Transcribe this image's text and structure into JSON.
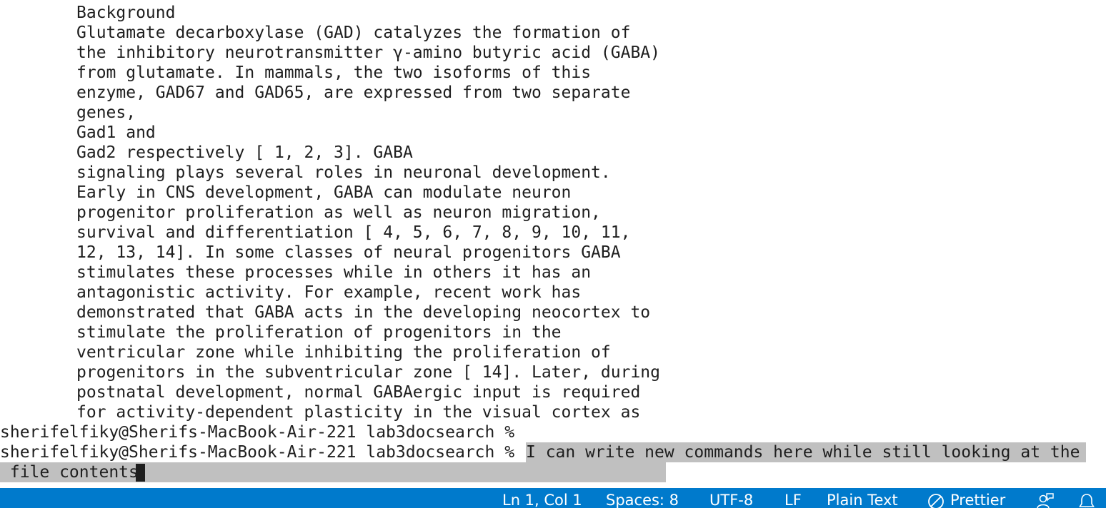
{
  "terminal": {
    "lines": [
      "Background",
      "Glutamate decarboxylase (GAD) catalyzes the formation of",
      "the inhibitory neurotransmitter γ-amino butyric acid (GABA)",
      "from glutamate. In mammals, the two isoforms of this",
      "enzyme, GAD67 and GAD65, are expressed from two separate",
      "genes,",
      "Gad1 and",
      "Gad2 respectively [ 1, 2, 3]. GABA",
      "signaling plays several roles in neuronal development.",
      "Early in CNS development, GABA can modulate neuron",
      "progenitor proliferation as well as neuron migration,",
      "survival and differentiation [ 4, 5, 6, 7, 8, 9, 10, 11,",
      "12, 13, 14]. In some classes of neural progenitors GABA",
      "stimulates these processes while in others it has an",
      "antagonistic activity. For example, recent work has",
      "demonstrated that GABA acts in the developing neocortex to",
      "stimulate the proliferation of progenitors in the",
      "ventricular zone while inhibiting the proliferation of",
      "progenitors in the subventricular zone [ 14]. Later, during",
      "postnatal development, normal GABAergic input is required",
      "for activity-dependent plasticity in the visual cortex as"
    ],
    "prompt_1": "sherifelfiky@Sherifs-MacBook-Air-221 lab3docsearch %",
    "prompt_2": "sherifelfiky@Sherifs-MacBook-Air-221 lab3docsearch %",
    "input_line_1": "I can write new commands here while still looking at the",
    "input_line_2": " file contents"
  },
  "statusbar": {
    "position": "Ln 1, Col 1",
    "spaces": "Spaces: 8",
    "encoding": "UTF-8",
    "eol": "LF",
    "language": "Plain Text",
    "formatter": "Prettier",
    "accent_color": "#007acc",
    "icons": [
      "prettier-disabled-icon",
      "feedback-icon",
      "bell-icon"
    ]
  }
}
